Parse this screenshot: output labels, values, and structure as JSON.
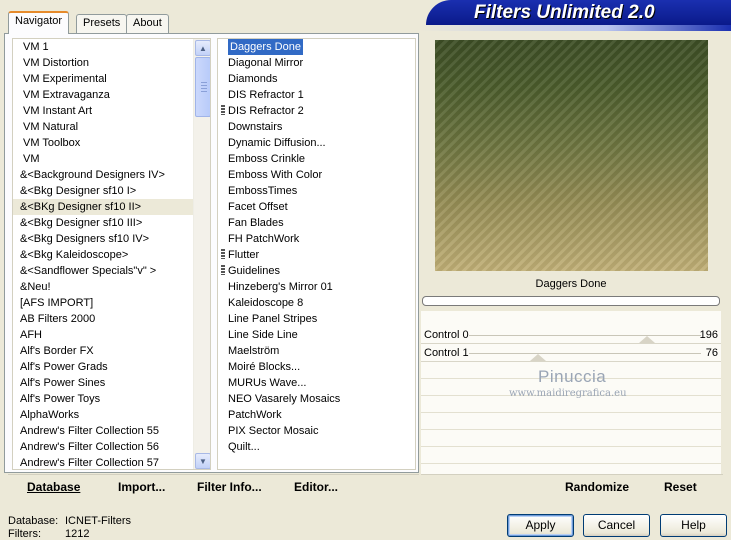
{
  "app": {
    "title": "Filters Unlimited 2.0"
  },
  "tabs": [
    {
      "label": "Navigator"
    },
    {
      "label": "Presets"
    },
    {
      "label": "About"
    }
  ],
  "categories": {
    "items": [
      "VM 1",
      "VM Distortion",
      "VM Experimental",
      "VM Extravaganza",
      "VM Instant Art",
      "VM Natural",
      "VM Toolbox",
      "VM",
      "&<Background Designers IV>",
      "&<Bkg Designer sf10 I>",
      "&<BKg Designer sf10 II>",
      "&<Bkg Designer sf10 III>",
      "&<Bkg Designers sf10 IV>",
      "&<Bkg Kaleidoscope>",
      "&<Sandflower Specials\"v\" >",
      "&Neu!",
      "[AFS IMPORT]",
      "AB Filters 2000",
      "AFH",
      "Alf's Border FX",
      "Alf's Power Grads",
      "Alf's Power Sines",
      "Alf's Power Toys",
      "AlphaWorks",
      "Andrew's Filter Collection 55",
      "Andrew's Filter Collection 56",
      "Andrew's Filter Collection 57"
    ],
    "selected_index": 10
  },
  "filters": {
    "items": [
      {
        "label": "Daggers Done",
        "group": false
      },
      {
        "label": "Diagonal Mirror",
        "group": false
      },
      {
        "label": "Diamonds",
        "group": false
      },
      {
        "label": "DIS Refractor 1",
        "group": false
      },
      {
        "label": "DIS Refractor 2",
        "group": true
      },
      {
        "label": "Downstairs",
        "group": false
      },
      {
        "label": "Dynamic Diffusion...",
        "group": false
      },
      {
        "label": "Emboss Crinkle",
        "group": false
      },
      {
        "label": "Emboss With Color",
        "group": false
      },
      {
        "label": "EmbossTimes",
        "group": false
      },
      {
        "label": "Facet Offset",
        "group": false
      },
      {
        "label": "Fan Blades",
        "group": false
      },
      {
        "label": "FH PatchWork",
        "group": false
      },
      {
        "label": "Flutter",
        "group": true
      },
      {
        "label": "Guidelines",
        "group": true
      },
      {
        "label": "Hinzeberg's Mirror 01",
        "group": false
      },
      {
        "label": "Kaleidoscope 8",
        "group": false
      },
      {
        "label": "Line Panel Stripes",
        "group": false
      },
      {
        "label": "Line Side Line",
        "group": false
      },
      {
        "label": "Maelström",
        "group": false
      },
      {
        "label": "Moiré Blocks...",
        "group": false
      },
      {
        "label": "MURUs Wave...",
        "group": false
      },
      {
        "label": "NEO Vasarely Mosaics",
        "group": false
      },
      {
        "label": "PatchWork",
        "group": false
      },
      {
        "label": "PIX Sector Mosaic",
        "group": false
      },
      {
        "label": "Quilt...",
        "group": false
      }
    ],
    "selected_index": 0
  },
  "left_toolbar": {
    "database": "Database",
    "import": "Import...",
    "filter_info": "Filter Info...",
    "editor": "Editor..."
  },
  "preview": {
    "filter_name": "Daggers Done",
    "progress": 0
  },
  "controls": [
    {
      "label": "Control 0",
      "value": "196",
      "max": 255
    },
    {
      "label": "Control  1",
      "value": "76",
      "max": 255
    }
  ],
  "right_toolbar": {
    "randomize": "Randomize",
    "reset": "Reset"
  },
  "watermark": {
    "line1": "Pinuccia",
    "line2": "www.maidiregrafica.eu"
  },
  "status": {
    "database_label": "Database:",
    "database_value": "ICNET-Filters",
    "filters_label": "Filters:",
    "filters_value": "1212"
  },
  "buttons": {
    "apply": "Apply",
    "cancel": "Cancel",
    "help": "Help"
  }
}
